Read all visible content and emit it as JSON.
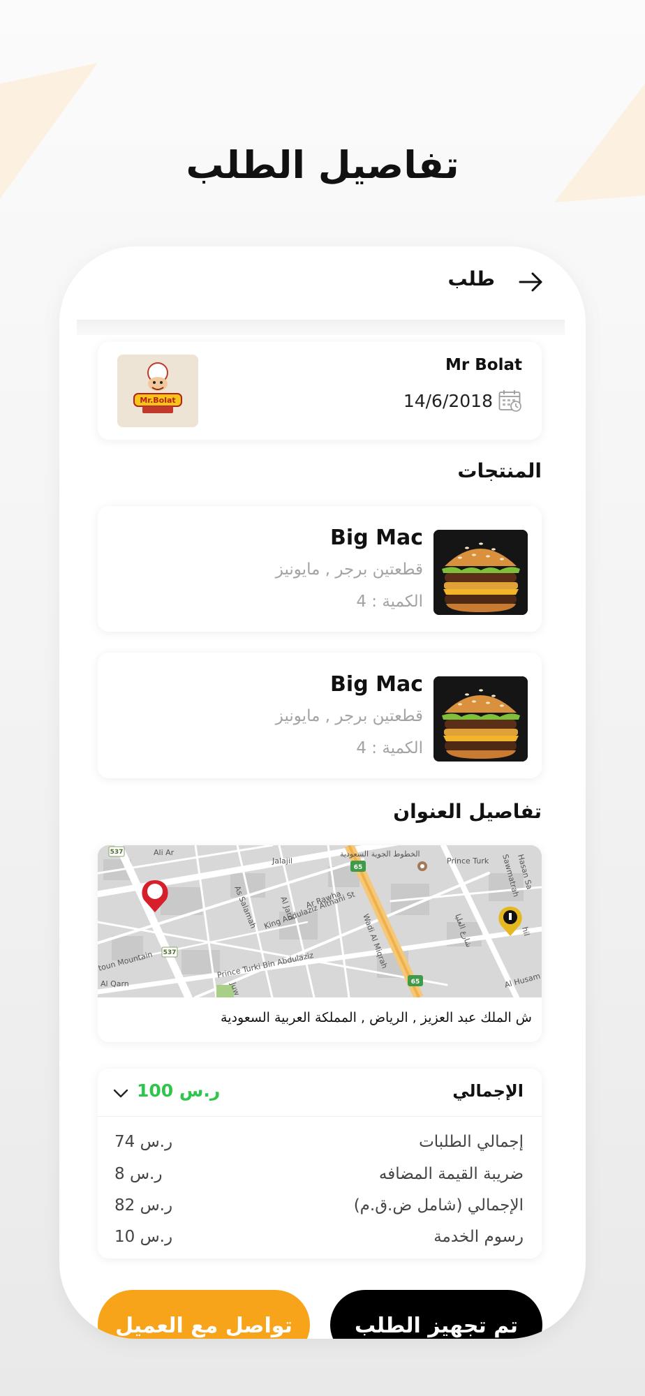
{
  "page": {
    "title": "تفاصيل الطلب"
  },
  "topbar": {
    "title": "طلب"
  },
  "shop": {
    "name": "Mr Bolat",
    "date": "14/6/2018"
  },
  "products": {
    "section_title": "المنتجات",
    "items": [
      {
        "name": "Big Mac",
        "description": "قطعتين برجر , مايونيز",
        "quantity": "الكمية : 4"
      },
      {
        "name": "Big Mac",
        "description": "قطعتين برجر , مايونيز",
        "quantity": "الكمية : 4"
      }
    ]
  },
  "address": {
    "section_title": "تفاصيل العنوان",
    "text": "ش الملك عبد العزيز , الرياض ,  المملكة العربية السعودية",
    "map_labels": {
      "road_537a": "537",
      "road_537b": "537",
      "road_65a": "65",
      "road_65b": "65",
      "airline": "الخطوط الجوية السعودية",
      "ali_ar": "Ali Ar",
      "jalajil": "Jalajil",
      "as_salamah": "As Salamah",
      "al_jarir": "Al Jarif",
      "ar_rawha": "Ar Rawha",
      "abdulaziz": "King Abdulaziz Althani St",
      "wadi": "Wadi Al Miqrah",
      "prince_turki": "Prince Turki Bin Abdulaziz",
      "prince_turki_short": "Prince Turk",
      "mountain": "toun Mountain",
      "qarn": "Al Qarn",
      "jun": "Juw",
      "hasan": "Hasan Sa",
      "sawmatah": "Sawmatrah",
      "ulaya_ar": "شارع العليا",
      "husam": "Al Husam",
      "hil": "hil"
    }
  },
  "totals": {
    "label": "الإجمالي",
    "value": "100 ر.س",
    "lines": [
      {
        "label": "إجمالي الطلبات",
        "value": "74 ر.س"
      },
      {
        "label": "ضريبة القيمة المضافه",
        "value": "8 ر.س"
      },
      {
        "label": "الإجمالي (شامل ض.ق.م)",
        "value": "82 ر.س"
      },
      {
        "label": "رسوم الخدمة",
        "value": "10 ر.س"
      }
    ]
  },
  "buttons": {
    "primary": "تم تجهيز الطلب",
    "secondary": "تواصل مع العميل"
  },
  "colors": {
    "accent_green": "#2ec64a",
    "accent_orange": "#f7a41a",
    "pin_red": "#d71f2b",
    "pin_gold": "#e5b81f"
  }
}
